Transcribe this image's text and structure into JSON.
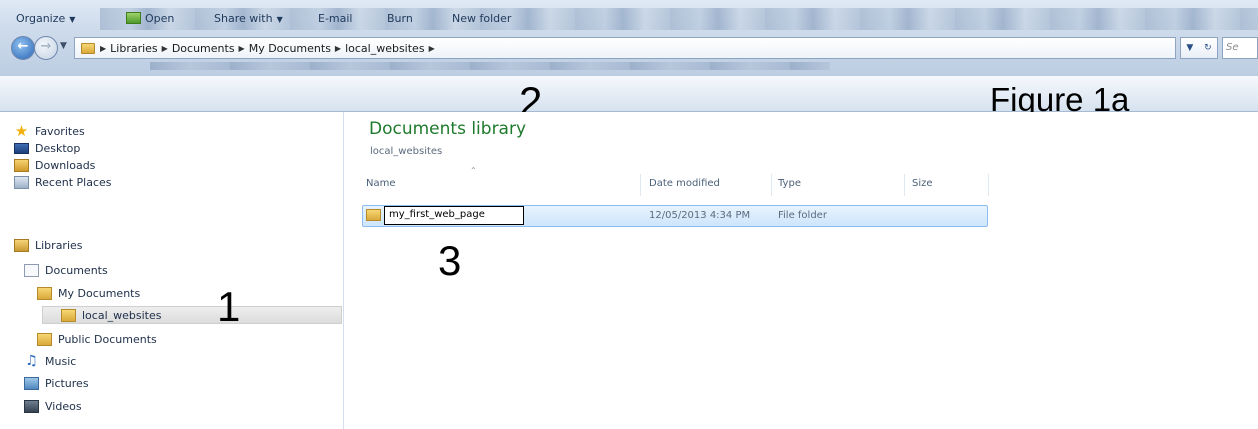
{
  "address_bar": {
    "breadcrumbs": [
      "Libraries",
      "Documents",
      "My Documents",
      "local_websites"
    ],
    "search_placeholder": "Se"
  },
  "toolbar": {
    "organize": "Organize",
    "open": "Open",
    "share_with": "Share with",
    "email": "E-mail",
    "burn": "Burn",
    "new_folder": "New folder"
  },
  "annotations": {
    "step1": "1",
    "step2": "2",
    "step3": "3",
    "figure_label": "Figure 1a"
  },
  "nav_pane": {
    "favorites": {
      "label": "Favorites",
      "items": [
        "Desktop",
        "Downloads",
        "Recent Places"
      ]
    },
    "libraries": {
      "label": "Libraries",
      "documents": "Documents",
      "my_documents": "My Documents",
      "local_websites": "local_websites",
      "public_documents": "Public Documents",
      "music": "Music",
      "pictures": "Pictures",
      "videos": "Videos"
    },
    "selected": "local_websites"
  },
  "content": {
    "library_title": "Documents library",
    "library_subtitle": "local_websites",
    "columns": [
      "Name",
      "Date modified",
      "Type",
      "Size"
    ],
    "rows": [
      {
        "name": "my_first_web_page",
        "date_modified": "12/05/2013 4:34 PM",
        "type": "File folder",
        "size": ""
      }
    ]
  },
  "colors": {
    "library_title": "#1e7a2c",
    "selection_fill": "#cde5fb",
    "selection_border": "#8dbdf0",
    "command_text": "#1e395b"
  }
}
